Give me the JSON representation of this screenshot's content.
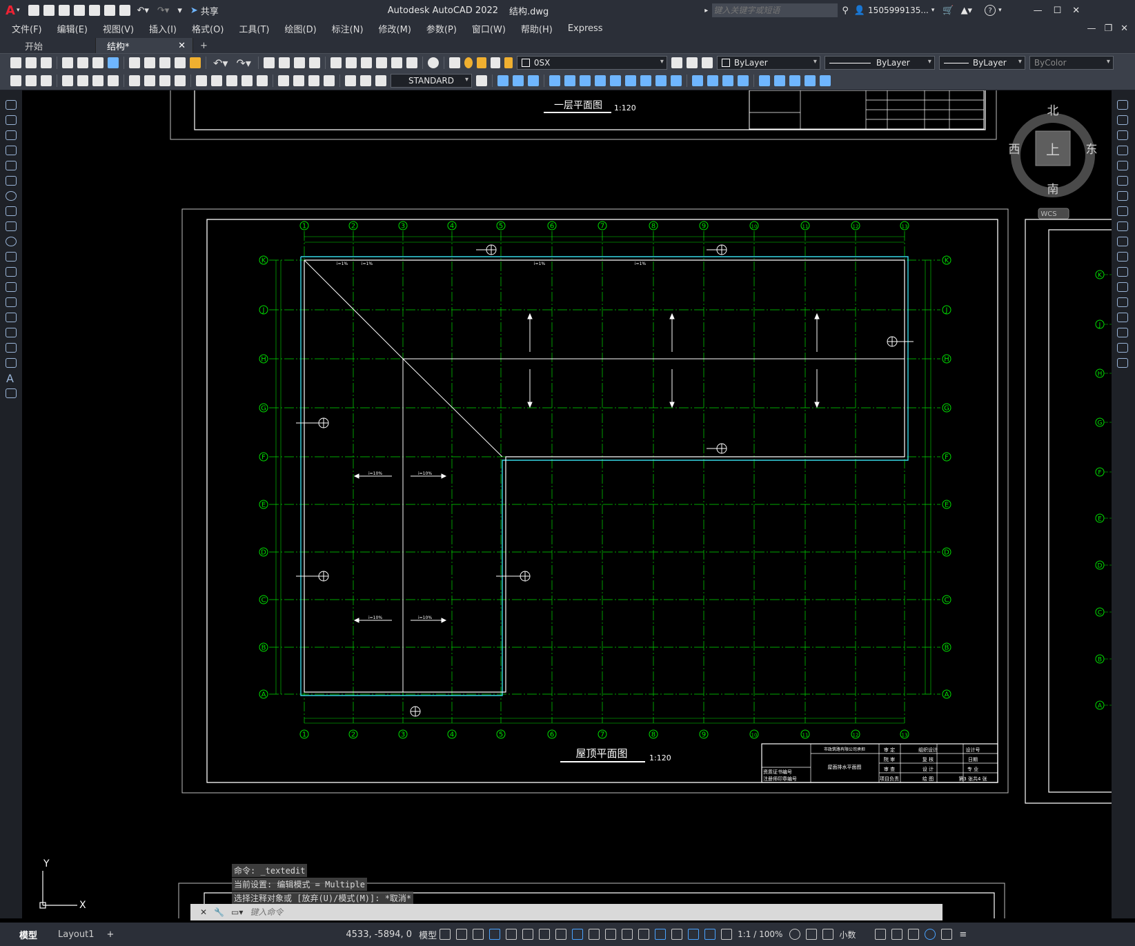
{
  "app": {
    "title": "Autodesk AutoCAD 2022",
    "filename": "结构.dwg",
    "search_placeholder": "键入关键字或短语",
    "username": "1505999135...",
    "share_label": "共享"
  },
  "menu": [
    "文件(F)",
    "编辑(E)",
    "视图(V)",
    "插入(I)",
    "格式(O)",
    "工具(T)",
    "绘图(D)",
    "标注(N)",
    "修改(M)",
    "参数(P)",
    "窗口(W)",
    "帮助(H)",
    "Express"
  ],
  "tabs": [
    {
      "label": "开始",
      "active": false
    },
    {
      "label": "结构*",
      "active": true
    }
  ],
  "toolbar": {
    "layer": "0SX",
    "color": "ByLayer",
    "linetype": "ByLayer",
    "lineweight": "ByLayer",
    "plotstyle": "ByColor",
    "textstyle": "STANDARD"
  },
  "viewcube": {
    "north": "北",
    "south": "南",
    "east": "东",
    "west": "西",
    "top": "上",
    "wcs": "WCS"
  },
  "drawing": {
    "top_title": "一层平面图",
    "top_scale": "1:120",
    "main_title": "屋顶平面图",
    "main_scale": "1:120",
    "grid_columns": [
      "1",
      "2",
      "3",
      "4",
      "5",
      "6",
      "7",
      "8",
      "9",
      "10",
      "11",
      "12",
      "13"
    ],
    "grid_rows": [
      "K",
      "J",
      "H",
      "G",
      "F",
      "E",
      "D",
      "C",
      "B",
      "A"
    ],
    "right_rows": [
      "K",
      "J",
      "H",
      "G",
      "F",
      "E",
      "D",
      "C",
      "B",
      "A"
    ],
    "slope_labels": [
      "i=1%",
      "i=1%",
      "i=1%",
      "i=1%",
      "i=10%",
      "i=10%",
      "i=10%",
      "i=10%"
    ],
    "title_block": {
      "company": "市政筑路有限公司承担",
      "drawing_name": "屋面排水平面图",
      "rows": [
        [
          "审 定",
          "",
          "组织设计",
          "设计号"
        ],
        [
          "院 审",
          "",
          "复 核",
          "日期"
        ],
        [
          "审 查",
          "",
          "设 计",
          "专 业"
        ],
        [
          "项目负责",
          "",
          "绘 图",
          "第3 张共4 张"
        ]
      ],
      "cert": [
        "资质证书编号",
        "注册师印章编号"
      ]
    }
  },
  "command": {
    "history": [
      "命令: _textedit",
      "当前设置: 编辑模式 = Multiple",
      "选择注释对象或 [放弃(U)/模式(M)]: *取消*"
    ],
    "input_placeholder": "键入命令"
  },
  "ucs": {
    "x": "X",
    "y": "Y"
  },
  "status": {
    "layout_tabs": [
      "模型",
      "Layout1"
    ],
    "coords": "4533, -5894, 0",
    "model_label": "模型",
    "scale": "1:1 / 100%",
    "units": "小数"
  },
  "colors": {
    "grid_green": "#00e000",
    "wall_cyan": "#37d7e6",
    "bg": "#000000",
    "chrome": "#2b2f38"
  }
}
